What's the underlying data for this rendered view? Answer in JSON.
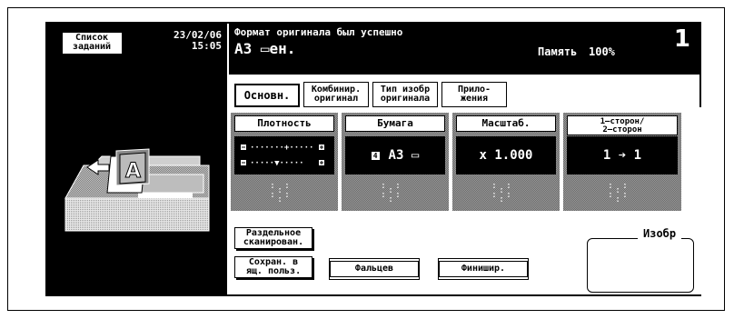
{
  "job_list": {
    "line1": "Список",
    "line2": "заданий"
  },
  "datetime": {
    "date": "23/02/06",
    "time": "15:05"
  },
  "status": {
    "message": "Формат оригинала был успешно",
    "format": "A3 ▭ен.",
    "memory_label": "Память",
    "memory_value": "100%",
    "copies": "1"
  },
  "tabs": [
    {
      "label": "Основн."
    },
    {
      "line1": "Комбинир.",
      "line2": "оригинал"
    },
    {
      "line1": "Тип изобр",
      "line2": "оригинала"
    },
    {
      "line1": "Прило-",
      "line2": "жения"
    }
  ],
  "cards": {
    "density": {
      "title": "Плотность"
    },
    "paper": {
      "title": "Бумага",
      "badge": "4",
      "value": "A3 ▭"
    },
    "zoom": {
      "title": "Масштаб.",
      "value": "x 1.000"
    },
    "duplex": {
      "title_line1": "1–сторон/",
      "title_line2": "2–сторон",
      "value": "1 ➔ 1"
    }
  },
  "buttons": {
    "separate_scan": {
      "line1": "Раздельное",
      "line2": "сканирован."
    },
    "save_box": {
      "line1": "Сохран. в",
      "line2": "ящ. польз."
    },
    "fold": "Фальцев",
    "finish": "Финишир."
  },
  "image_label": "Изобр",
  "icons": {
    "feed_arrow": "arrow-left-icon",
    "original": "paper-A-icon"
  }
}
